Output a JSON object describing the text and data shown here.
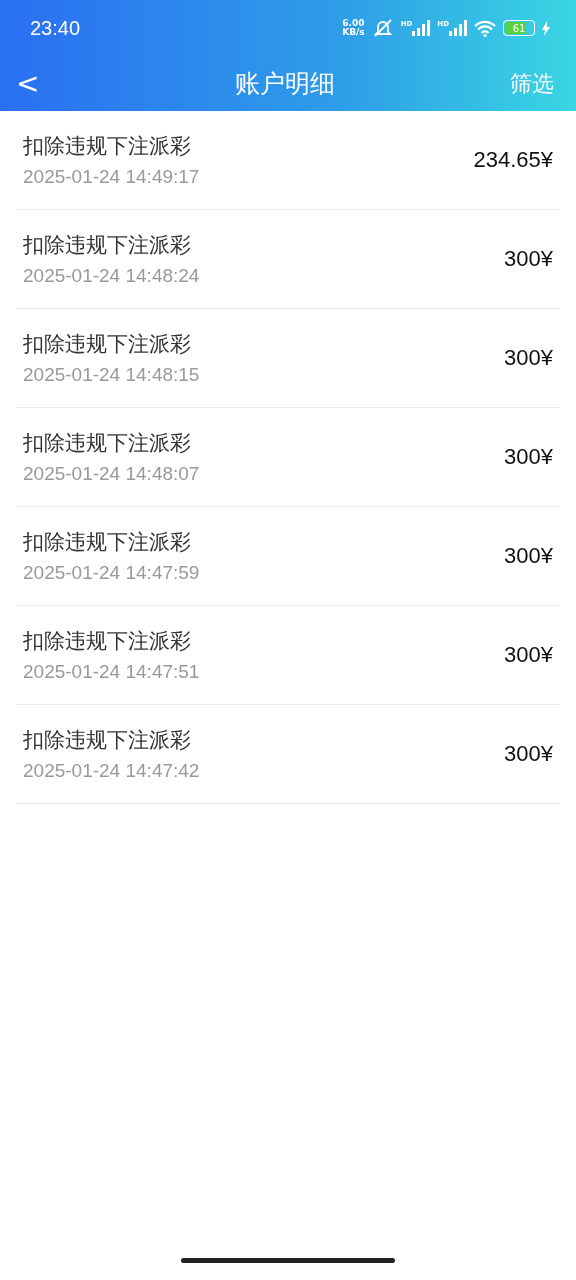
{
  "status_bar": {
    "time": "23:40",
    "speed_value": "6.00",
    "speed_unit": "KB/s",
    "sim_labels": [
      "HD",
      "HD"
    ],
    "battery": "61"
  },
  "nav": {
    "back": "<",
    "title": "账户明细",
    "action": "筛选"
  },
  "records": [
    {
      "title": "扣除违规下注派彩",
      "time": "2025-01-24 14:49:17",
      "amount": "234.65¥"
    },
    {
      "title": "扣除违规下注派彩",
      "time": "2025-01-24 14:48:24",
      "amount": "300¥"
    },
    {
      "title": "扣除违规下注派彩",
      "time": "2025-01-24 14:48:15",
      "amount": "300¥"
    },
    {
      "title": "扣除违规下注派彩",
      "time": "2025-01-24 14:48:07",
      "amount": "300¥"
    },
    {
      "title": "扣除违规下注派彩",
      "time": "2025-01-24 14:47:59",
      "amount": "300¥"
    },
    {
      "title": "扣除违规下注派彩",
      "time": "2025-01-24 14:47:51",
      "amount": "300¥"
    },
    {
      "title": "扣除违规下注派彩",
      "time": "2025-01-24 14:47:42",
      "amount": "300¥"
    }
  ]
}
